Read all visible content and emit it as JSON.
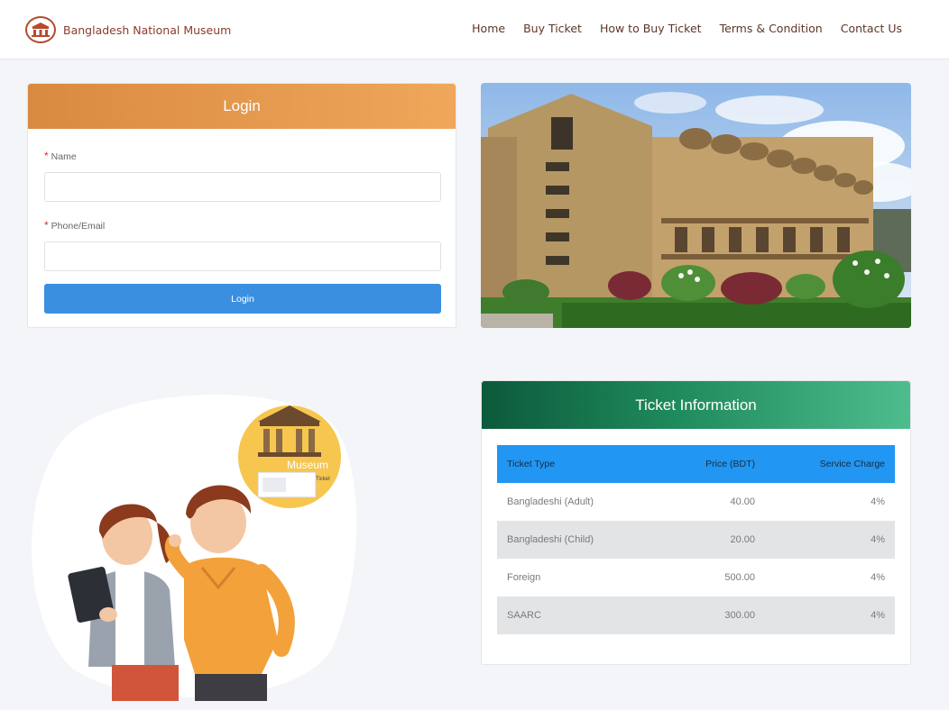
{
  "header": {
    "brand_name": "Bangladesh National Museum",
    "nav": [
      "Home",
      "Buy Ticket",
      "How to Buy Ticket",
      "Terms & Condition",
      "Contact Us"
    ]
  },
  "login": {
    "title": "Login",
    "name_label": "Name",
    "name_value": "",
    "contact_label": "Phone/Email",
    "contact_value": "",
    "button_label": "Login"
  },
  "illustration": {
    "sign_text": "Museum",
    "ticket_text": "Ticket"
  },
  "ticket_info": {
    "title": "Ticket Information",
    "columns": [
      "Ticket Type",
      "Price (BDT)",
      "Service Charge"
    ],
    "rows": [
      [
        "Bangladeshi (Adult)",
        "40.00",
        "4%"
      ],
      [
        "Bangladeshi (Child)",
        "20.00",
        "4%"
      ],
      [
        "Foreign",
        "500.00",
        "4%"
      ],
      [
        "SAARC",
        "300.00",
        "4%"
      ]
    ]
  },
  "colors": {
    "login_header": "#e89a4c",
    "login_button": "#3a8fe0",
    "ticket_header": "#1f8a5c",
    "table_header": "#2196f3",
    "brand": "#8a3b2a"
  }
}
